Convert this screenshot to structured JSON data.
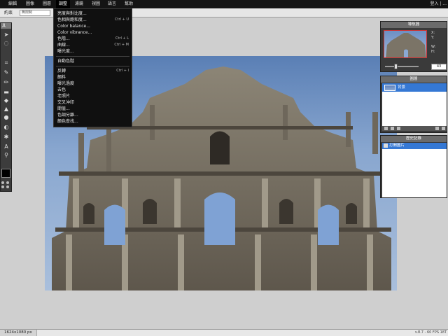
{
  "menubar": {
    "items": [
      "編輯",
      "圖像",
      "圖層",
      "調整",
      "濾鏡",
      "視圖",
      "語言",
      "幫助"
    ],
    "active_index": 3,
    "right_text": "登入  |  ..."
  },
  "toolbar": {
    "label": "約束",
    "select_value": "無限制",
    "value_field": "1"
  },
  "tools": {
    "title": "具",
    "icons": [
      "arrow-icon",
      "lasso-icon",
      "crop-icon",
      "wand-icon",
      "pencil-icon",
      "brush-icon",
      "eraser-icon",
      "bucket-icon",
      "gradient-icon",
      "clone-icon",
      "blur-icon",
      "text-icon",
      "zoom-icon"
    ],
    "glyphs": [
      "➤",
      "◌",
      "⌗",
      "✎",
      "✏",
      "▬",
      "◆",
      "▲",
      "●",
      "◐",
      "✱",
      "A",
      "⚲"
    ],
    "foreground": "#000000"
  },
  "dropdown": {
    "items": [
      {
        "label": "亮度與對比度...",
        "shortcut": ""
      },
      {
        "label": "色相與飽和度...",
        "shortcut": "Ctrl + U"
      },
      {
        "label": "Color balance...",
        "shortcut": ""
      },
      {
        "label": "Color vibrance...",
        "shortcut": ""
      },
      {
        "label": "色階...",
        "shortcut": "Ctrl + L"
      },
      {
        "label": "曲線...",
        "shortcut": "Ctrl + M"
      },
      {
        "label": "曝光度...",
        "shortcut": ""
      },
      {
        "label": "自動色階",
        "shortcut": ""
      },
      {
        "label": "反轉",
        "shortcut": "Ctrl + I"
      },
      {
        "label": "顏料",
        "shortcut": ""
      },
      {
        "label": "曝光過度",
        "shortcut": ""
      },
      {
        "label": "去色",
        "shortcut": ""
      },
      {
        "label": "老照片",
        "shortcut": ""
      },
      {
        "label": "交叉沖印",
        "shortcut": ""
      },
      {
        "label": "閾值...",
        "shortcut": ""
      },
      {
        "label": "色調分離...",
        "shortcut": ""
      },
      {
        "label": "顏色查找...",
        "shortcut": ""
      }
    ]
  },
  "navigator": {
    "title": "導航器",
    "x_label": "X:",
    "y_label": "Y:",
    "w_label": "W:",
    "h_label": "H:",
    "zoom": "43"
  },
  "layers": {
    "title": "圖層",
    "rows": [
      {
        "name": "背景"
      }
    ]
  },
  "history": {
    "title": "歷史記錄",
    "rows": [
      {
        "name": "打開圖片"
      }
    ]
  },
  "statusbar": {
    "dimensions": "1624x1080 px",
    "version": "v.8.7 - 60 FPS 18T"
  },
  "colors": {
    "menubar_bg": "#141414",
    "selection_blue": "#3578d4",
    "panel_bg": "#3a3a3a",
    "workspace_bg": "#cfcfcf"
  }
}
